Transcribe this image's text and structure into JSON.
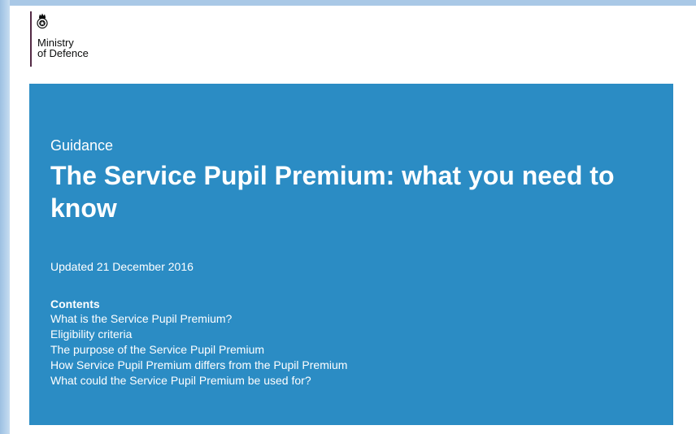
{
  "header": {
    "org_logo": {
      "name": "Ministry\nof Defence",
      "crest_icon": "royal-crest-icon",
      "accent_color": "#532a45"
    }
  },
  "hero": {
    "background_color": "#2b8cc4",
    "format_label": "Guidance",
    "title": "The Service Pupil Premium: what you need to know",
    "updated": "Updated 21 December 2016",
    "contents": {
      "heading": "Contents",
      "items": [
        "What is the Service Pupil Premium?",
        "Eligibility criteria",
        "The purpose of the Service Pupil Premium",
        "How Service Pupil Premium differs from the Pupil Premium",
        "What could the Service Pupil Premium be used for?"
      ]
    }
  }
}
